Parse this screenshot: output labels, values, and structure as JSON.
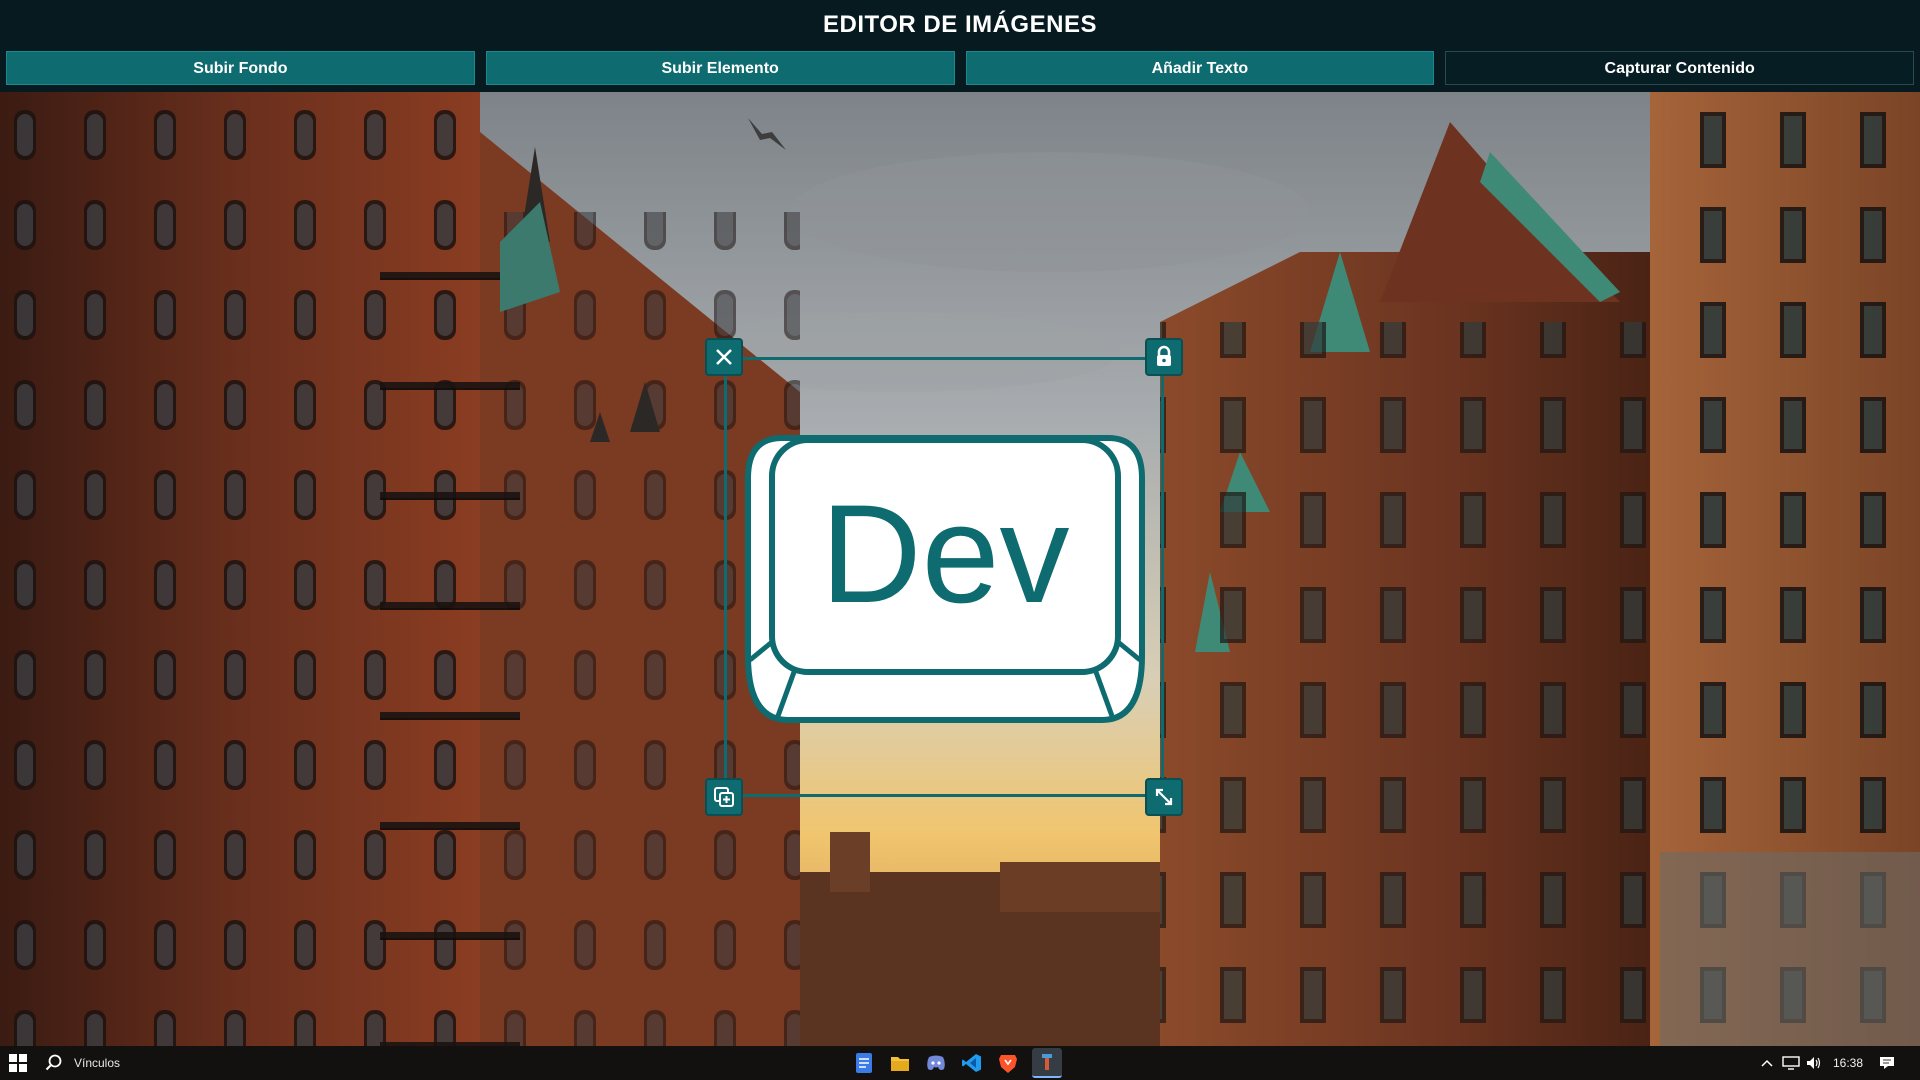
{
  "header": {
    "title": "EDITOR DE IMÁGENES",
    "buttons": [
      {
        "label": "Subir Fondo"
      },
      {
        "label": "Subir Elemento"
      },
      {
        "label": "Añadir Texto"
      },
      {
        "label": "Capturar Contenido"
      }
    ]
  },
  "element": {
    "logo_text": "Dev",
    "handles": [
      "close-icon",
      "lock-icon",
      "duplicate-icon",
      "resize-icon"
    ]
  },
  "taskbar": {
    "link_label": "Vínculos",
    "apps": [
      "docs-icon",
      "file-explorer-icon",
      "discord-icon",
      "vscode-icon",
      "brave-icon",
      "app-icon"
    ],
    "tray": [
      "chevron-up-icon",
      "network-icon",
      "volume-icon"
    ],
    "time": "16:38"
  },
  "colors": {
    "accent": "#0e6b70",
    "header_bg": "#061a20"
  }
}
